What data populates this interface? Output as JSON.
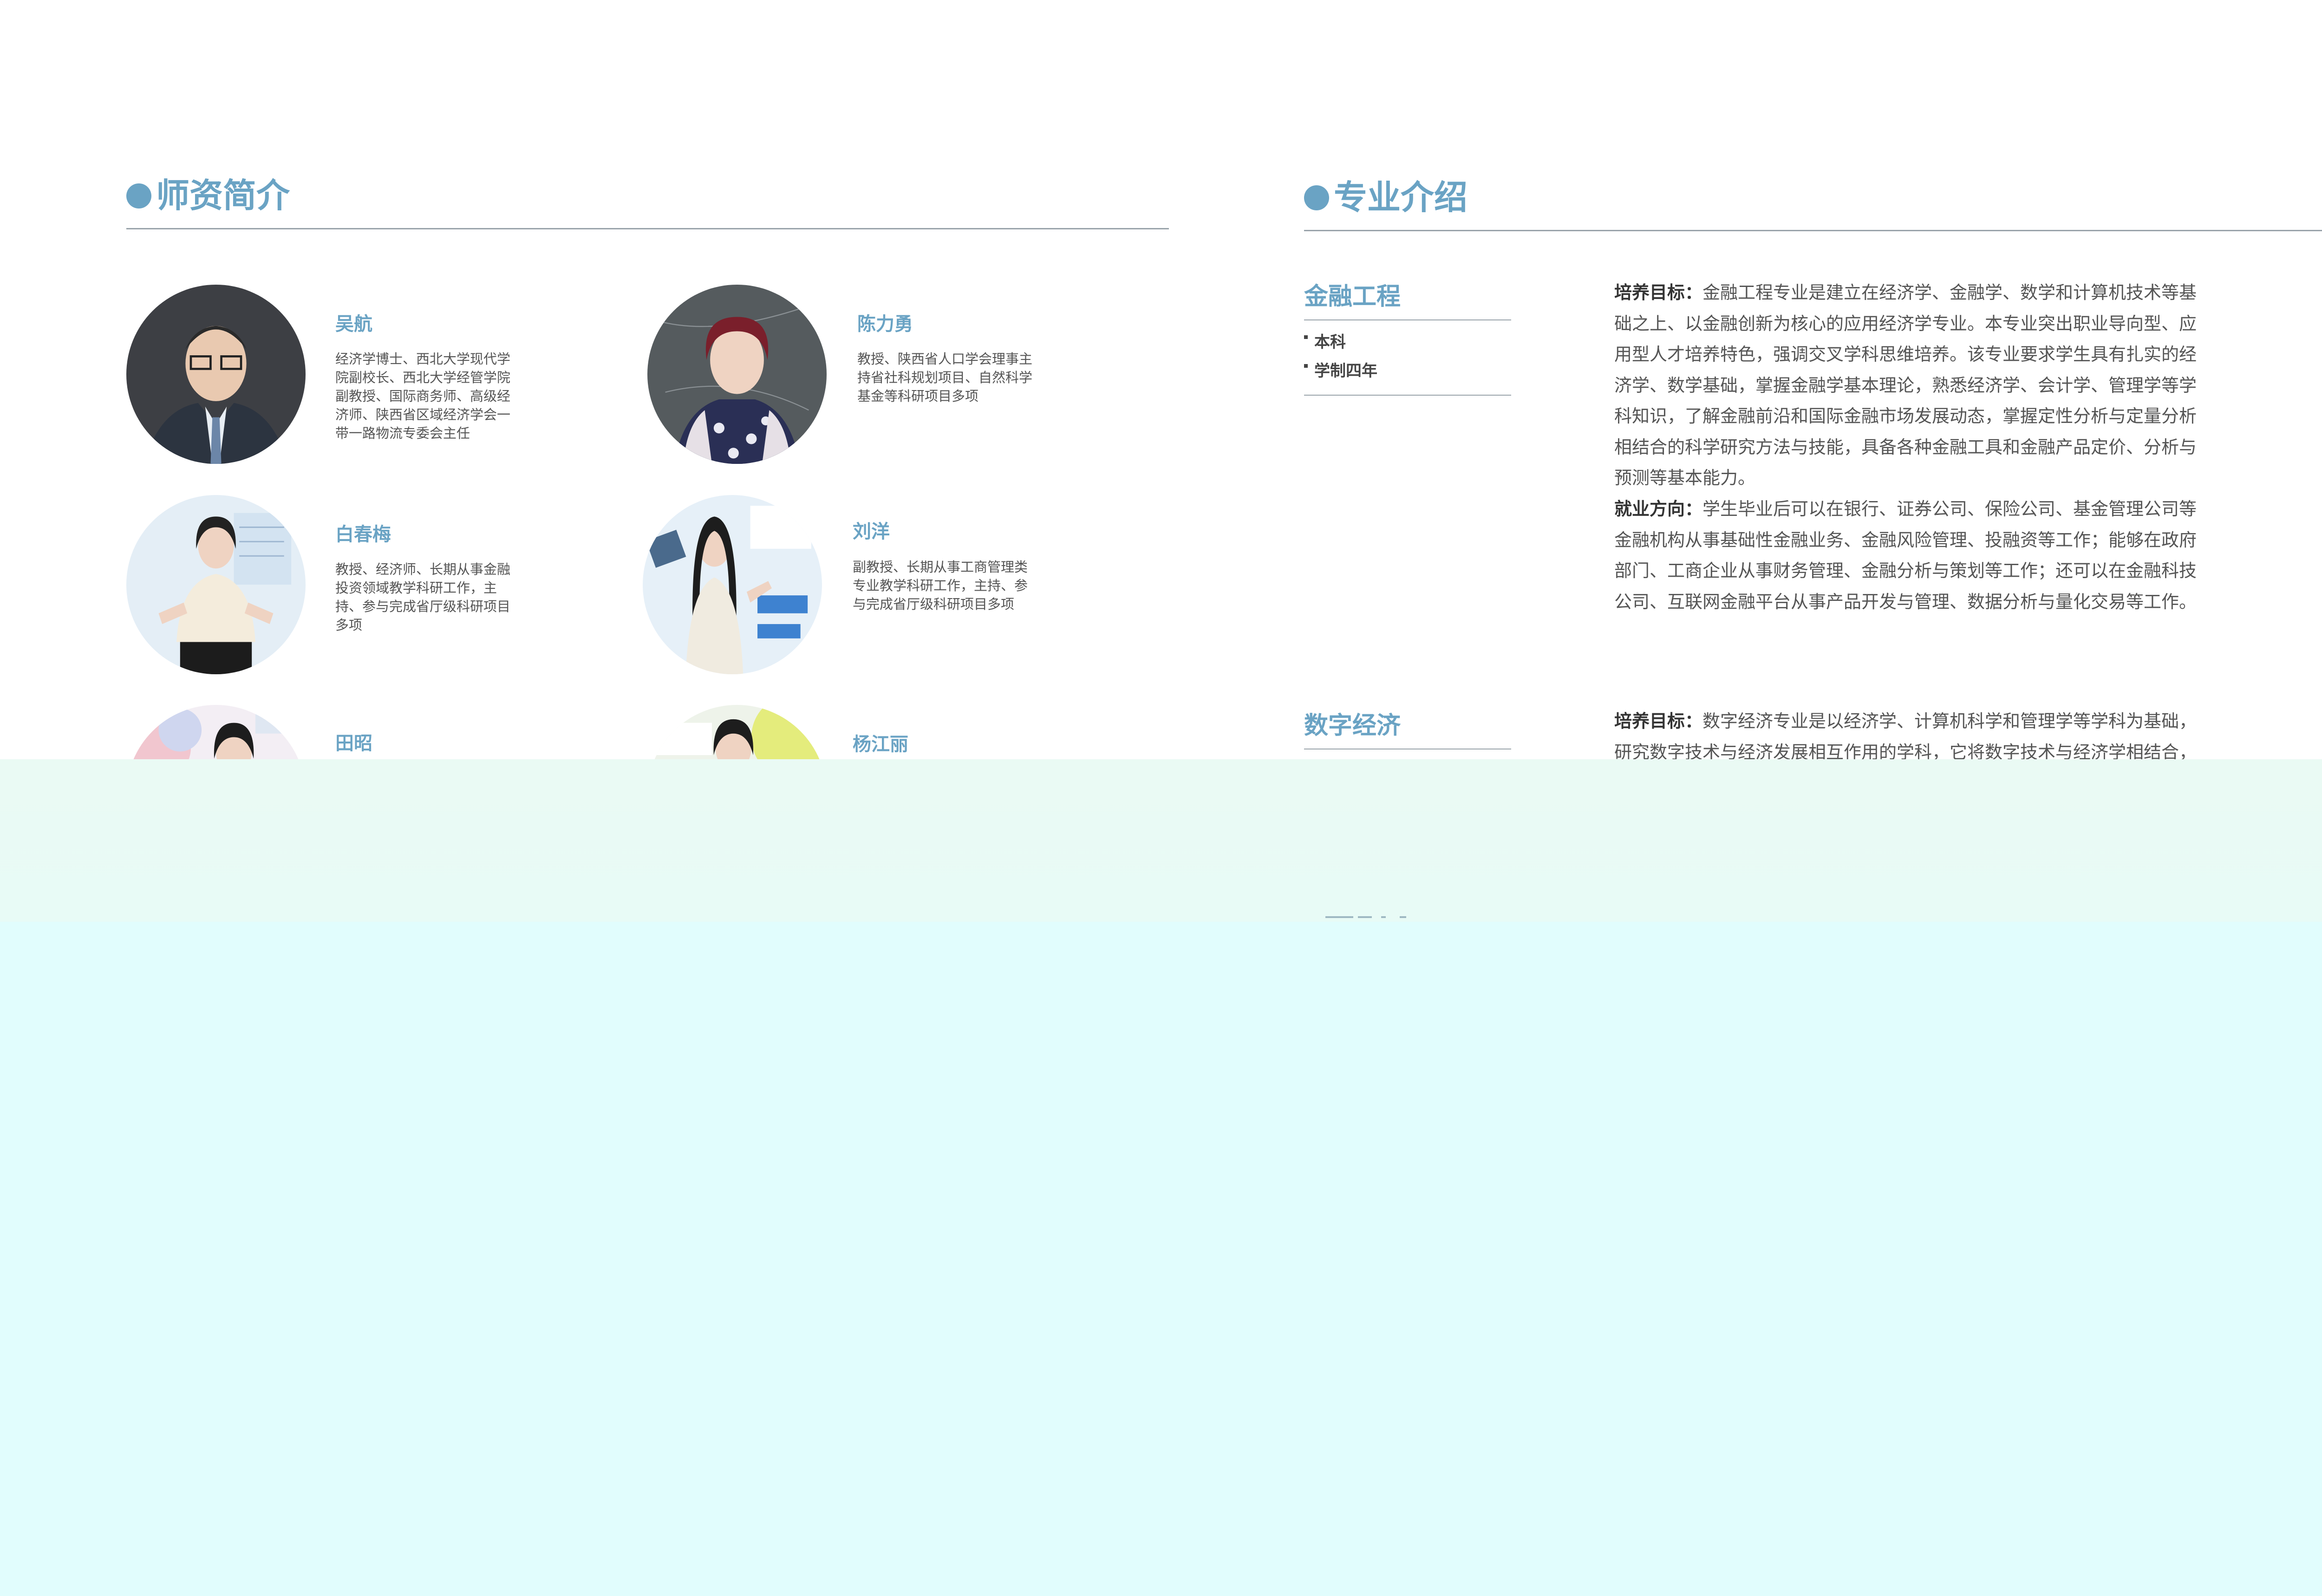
{
  "faculty_section": {
    "title": "师资简介",
    "members": [
      {
        "name": "吴航",
        "desc": "经济学博士、西北大学现代学院副校长、西北大学经管学院副教授、国际商务师、高级经济师、陕西省区域经济学会一带一路物流专委会主任",
        "photo": "portrait-photo"
      },
      {
        "name": "陈力勇",
        "desc": "教授、陕西省人口学会理事主持省社科规划项目、自然科学基金等科研项目多项",
        "photo": "portrait-photo"
      },
      {
        "name": "白春梅",
        "desc": "教授、经济师、长期从事金融投资领域教学科研工作，主持、参与完成省厅级科研项目多项",
        "photo": "portrait-photo"
      },
      {
        "name": "刘洋",
        "desc": "副教授、长期从事工商管理类专业教学科研工作，主持、参与完成省厅级科研项目多项",
        "photo": "portrait-photo"
      },
      {
        "name": "田昭",
        "desc": "",
        "photo": "portrait-photo"
      },
      {
        "name": "杨江丽",
        "desc": "",
        "photo": "portrait-photo"
      }
    ]
  },
  "major_section": {
    "title": "专业介绍",
    "majors": [
      {
        "name": "金融工程",
        "degree": "本科",
        "duration": "学制四年",
        "goal_label": "培养目标：",
        "goal_text": "金融工程专业是建立在经济学、金融学、数学和计算机技术等基础之上、以金融创新为核心的应用经济学专业。本专业突出职业导向型、应用型人才培养特色，强调交叉学科思维培养。该专业要求学生具有扎实的经济学、数学基础，掌握金融学基本理论，熟悉经济学、会计学、管理学等学科知识，了解金融前沿和国际金融市场发展动态，掌握定性分析与定量分析相结合的科学研究方法与技能，具备各种金融工具和金融产品定价、分析与预测等基本能力。",
        "career_label": "就业方向：",
        "career_text": "学生毕业后可以在银行、证券公司、保险公司、基金管理公司等金融机构从事基础性金融业务、金融风险管理、投融资等工作；能够在政府部门、工商企业从事财务管理、金融分析与策划等工作；还可以在金融科技公司、互联网金融平台从事产品开发与管理、数据分析与量化交易等工作。"
      },
      {
        "name": "数字经济",
        "goal_label": "培养目标：",
        "goal_text": "数字经济专业是以经济学、计算机科学和管理学等学科为基础，研究数字技术与经济发展相互作用的学科，它将数字技术与经济学相结合，研究和"
      }
    ]
  },
  "colors": {
    "accent": "#6aa3c4",
    "rule": "#9aa4ab",
    "overlay_light": "#e8fbf6",
    "overlay_cyan": "#e1fdfd"
  }
}
